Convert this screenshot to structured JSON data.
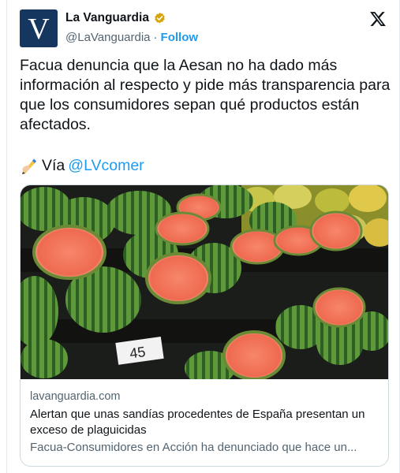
{
  "account": {
    "avatar_letter": "V",
    "display_name": "La Vanguardia",
    "handle": "@LaVanguardia",
    "separator": "·",
    "follow_label": "Follow",
    "verified_color": "#d4a40a",
    "avatar_color": "#15365f"
  },
  "icons": {
    "brand": "x-logo-icon",
    "verified": "verified-badge-icon",
    "via": "writing-hand-icon"
  },
  "tweet": {
    "text": "Facua denuncia que la Aesan no ha dado más información al respecto y pide más transparencia para que los consumidores sepan qué productos están afectados.",
    "via_label": "Vía",
    "via_mention": "@LVcomer"
  },
  "link_card": {
    "image_tag_text": "45",
    "domain": "lavanguardia.com",
    "headline": "Alertan que unas sandías procedentes de España presentan un exceso de plaguicidas",
    "description": "Facua-Consumidores en Acción ha denunciado que hace un..."
  },
  "colors": {
    "link_blue": "#1d9bf0",
    "secondary_text": "#536471",
    "primary_text": "#0f1419"
  }
}
